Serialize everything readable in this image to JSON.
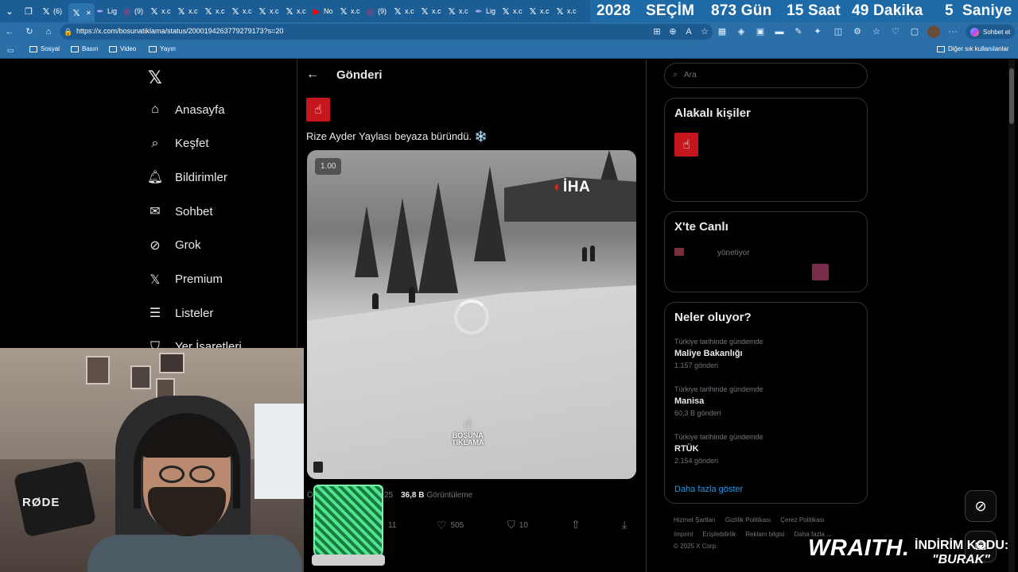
{
  "browser": {
    "tabs": [
      {
        "icon": "x-logo-icon",
        "label": "(6)"
      },
      {
        "icon": "x-logo-icon",
        "label": "",
        "active": true
      },
      {
        "icon": "feather-icon",
        "label": "Lig"
      },
      {
        "icon": "instagram-icon",
        "label": "(9)"
      },
      {
        "icon": "x-logo-icon",
        "label": "x.c"
      },
      {
        "icon": "x-logo-icon",
        "label": "x.c"
      },
      {
        "icon": "x-logo-icon",
        "label": "x.c"
      },
      {
        "icon": "x-logo-icon",
        "label": "x.c"
      },
      {
        "icon": "x-logo-icon",
        "label": "x.c"
      },
      {
        "icon": "x-logo-icon",
        "label": "x.c"
      },
      {
        "icon": "youtube-icon",
        "label": "No"
      },
      {
        "icon": "x-logo-icon",
        "label": "x.c"
      },
      {
        "icon": "instagram-icon",
        "label": "(9)"
      },
      {
        "icon": "x-logo-icon",
        "label": "x.c"
      },
      {
        "icon": "x-logo-icon",
        "label": "x.c"
      },
      {
        "icon": "x-logo-icon",
        "label": "x.c"
      },
      {
        "icon": "feather-icon",
        "label": "Lig"
      },
      {
        "icon": "x-logo-icon",
        "label": "x.c"
      },
      {
        "icon": "x-logo-icon",
        "label": "x.c"
      },
      {
        "icon": "x-logo-icon",
        "label": "x.c"
      }
    ],
    "countdown": {
      "year": "2028",
      "event": "SEÇİM",
      "days": "873 Gün",
      "hours": "15 Saat",
      "minutes": "49 Dakika",
      "seconds_value": "5",
      "seconds_label": "Saniye"
    },
    "url": "https://x.com/bosunatiklama/status/2000194263779279173?s=20",
    "chat_label": "Sohbet et",
    "bookmarks": [
      "Sosyal",
      "Basın",
      "Video",
      "Yayın"
    ],
    "other_bookmarks": "Diğer sık kullanılanlar",
    "colors": {
      "tabbar": "#1b5e95",
      "toolbar": "#2b6fa9"
    }
  },
  "sidebar": {
    "items": [
      {
        "label": "Anasayfa",
        "icon": "home-icon"
      },
      {
        "label": "Keşfet",
        "icon": "search-icon"
      },
      {
        "label": "Bildirimler",
        "icon": "bell-icon"
      },
      {
        "label": "Sohbet",
        "icon": "mail-icon"
      },
      {
        "label": "Grok",
        "icon": "grok-icon"
      },
      {
        "label": "Premium",
        "icon": "x-logo-icon"
      },
      {
        "label": "Listeler",
        "icon": "list-icon"
      },
      {
        "label": "Yer İşaretleri",
        "icon": "bookmark-icon"
      }
    ]
  },
  "post": {
    "header_title": "Gönderi",
    "text": "Rize Ayder Yaylası beyaza büründü. ❄️",
    "video": {
      "speed": "1.00",
      "agency": "İHA",
      "watermark_line1": "BOŞUNA",
      "watermark_line2": "TIKLAMA"
    },
    "meta": {
      "time_fragment": "Ö",
      "date_fragment": "25",
      "views_value": "36,8 B",
      "views_label": "Görüntüleme"
    },
    "actions": {
      "replies": "11",
      "likes": "505",
      "bookmarks": "10"
    }
  },
  "right": {
    "search_placeholder": "Ara",
    "related_title": "Alakalı kişiler",
    "live_title": "X'te Canlı",
    "live_subtitle": "yönetiyor",
    "trends_title": "Neler oluyor?",
    "trends": [
      {
        "context": "Türkiye tarihinde gündemde",
        "name": "Maliye Bakanlığı",
        "count": "1.157 gönderi"
      },
      {
        "context": "Türkiye tarihinde gündemde",
        "name": "Manisa",
        "count": "60,3 B gönderi"
      },
      {
        "context": "Türkiye tarihinde gündemde",
        "name": "RTÜK",
        "count": "2.154 gönderi"
      }
    ],
    "show_more": "Daha fazla göster",
    "footer": {
      "line1": [
        "Hizmet Şartları",
        "Gizlilik Politikası",
        "Çerez Politikası"
      ],
      "line2": [
        "Imprint",
        "Erişilebilirlik",
        "Reklam bilgisi",
        "Daha fazla ..."
      ],
      "copyright": "© 2025 X Corp."
    }
  },
  "overlay": {
    "mic_brand": "RØDE",
    "sponsor": "WRAITH.",
    "promo_line1": "İNDİRİM KODU:",
    "promo_line2": "\"BURAK\""
  }
}
